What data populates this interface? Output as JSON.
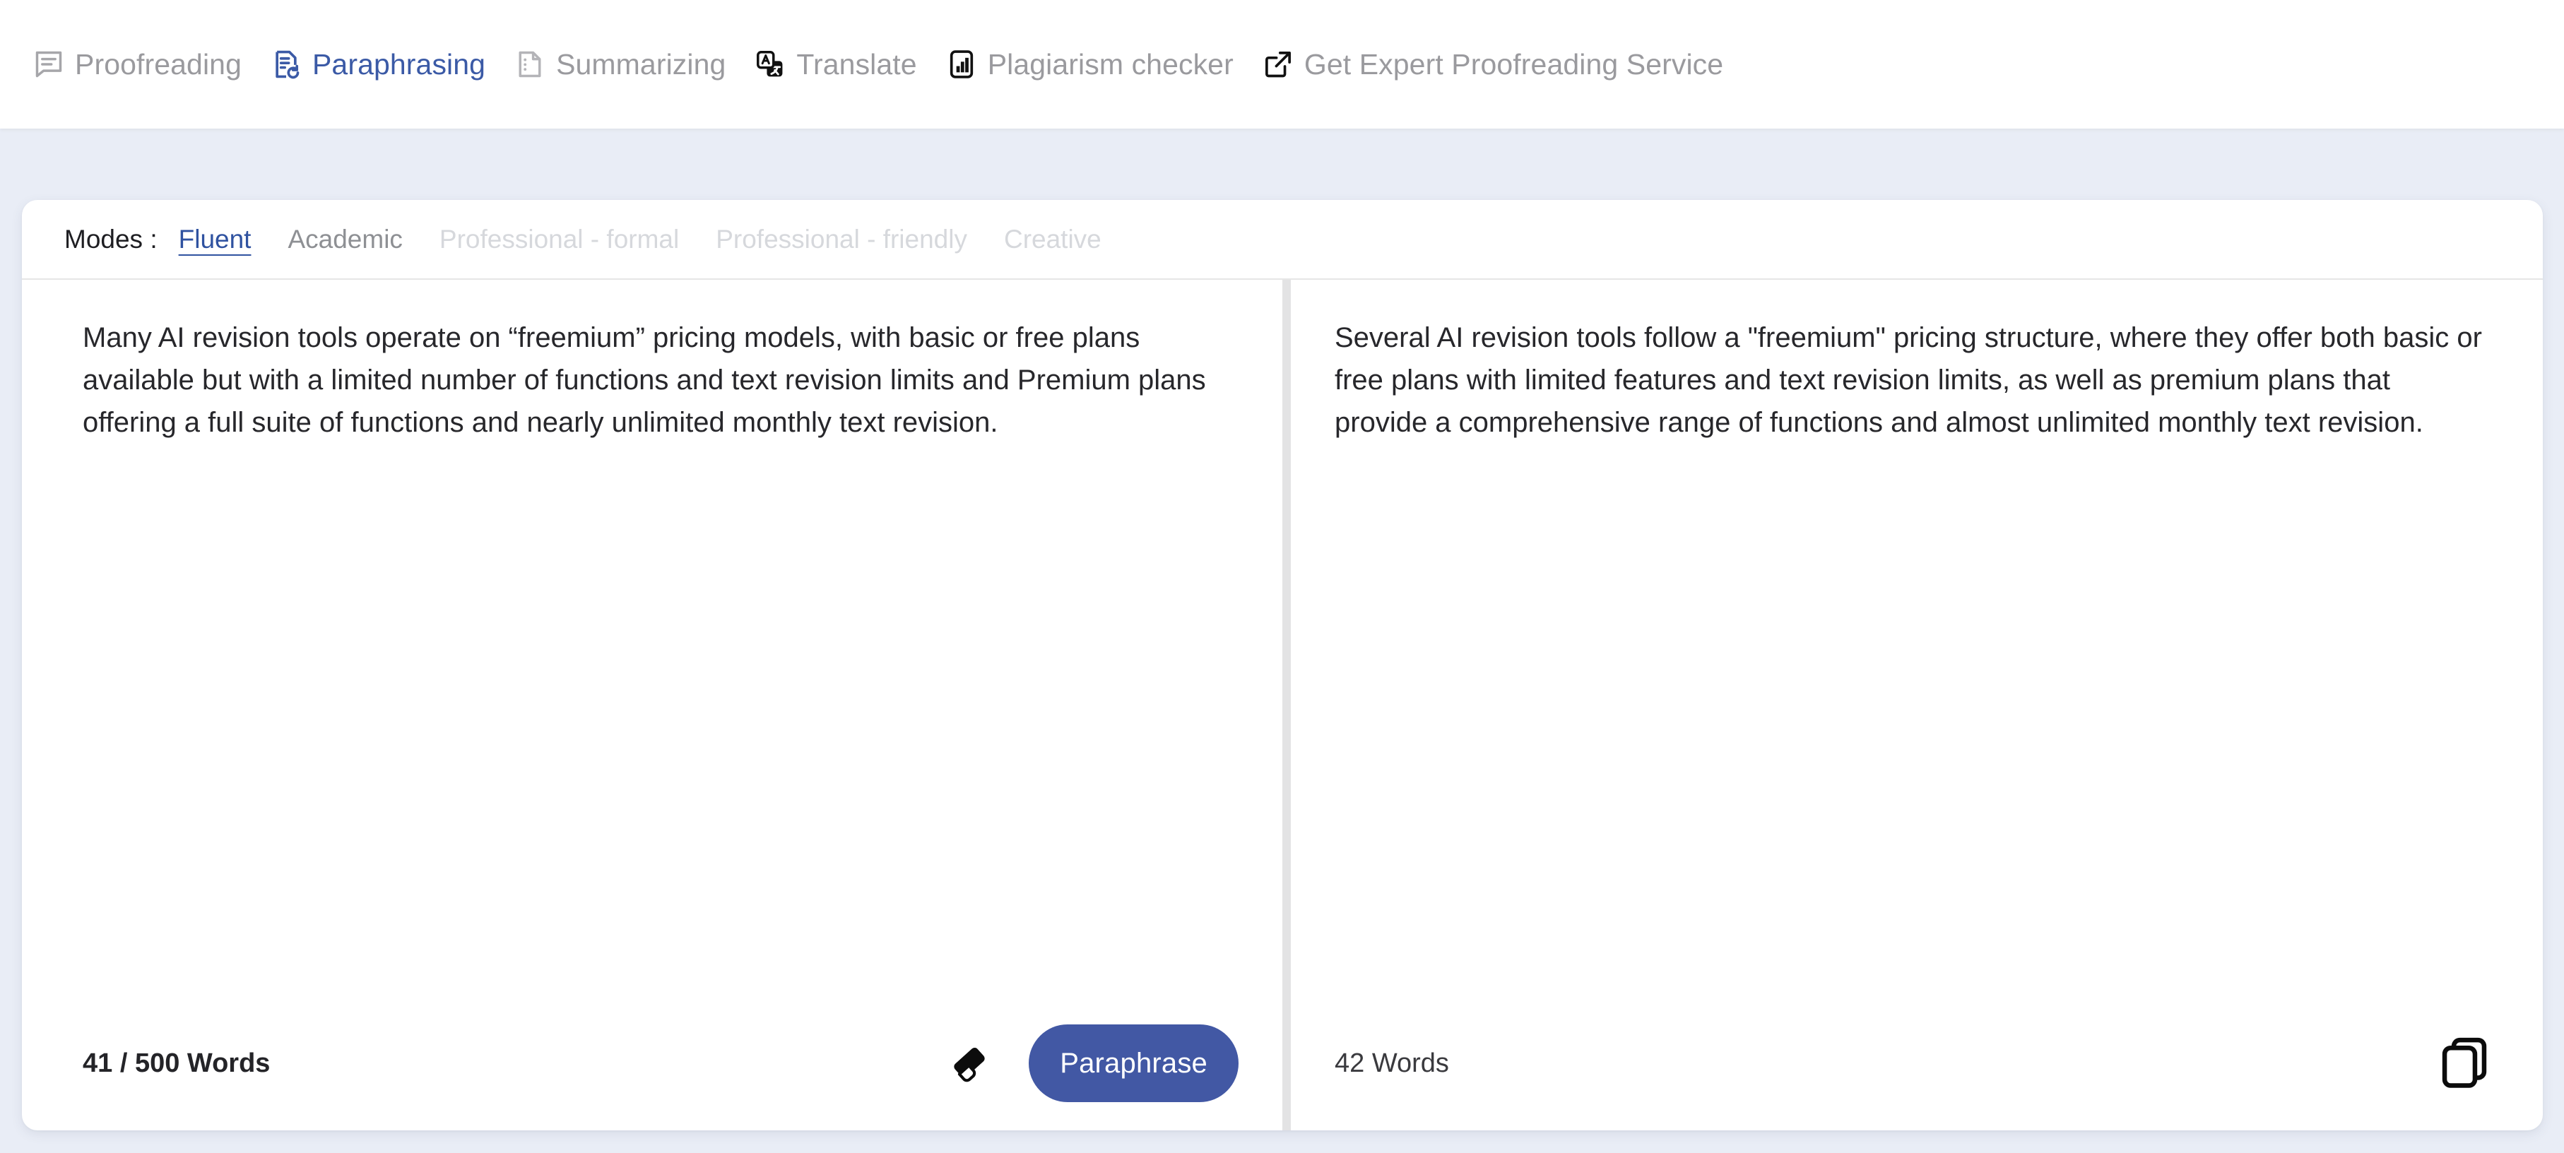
{
  "topnav": {
    "items": [
      {
        "id": "proofreading",
        "label": "Proofreading",
        "icon": "comment-lines-icon",
        "active": false
      },
      {
        "id": "paraphrasing",
        "label": "Paraphrasing",
        "icon": "document-revision-icon",
        "active": true
      },
      {
        "id": "summarizing",
        "label": "Summarizing",
        "icon": "document-summary-icon",
        "active": false
      },
      {
        "id": "translate",
        "label": "Translate",
        "icon": "translate-icon",
        "active": false
      },
      {
        "id": "plagiarism",
        "label": "Plagiarism checker",
        "icon": "bar-chart-icon",
        "active": false
      },
      {
        "id": "expert",
        "label": "Get Expert Proofreading Service",
        "icon": "external-link-icon",
        "active": false
      }
    ]
  },
  "modes": {
    "title": "Modes :",
    "items": [
      {
        "id": "fluent",
        "label": "Fluent",
        "state": "selected"
      },
      {
        "id": "academic",
        "label": "Academic",
        "state": "normal"
      },
      {
        "id": "professional-formal",
        "label": "Professional - formal",
        "state": "dim"
      },
      {
        "id": "professional-friendly",
        "label": "Professional - friendly",
        "state": "dim"
      },
      {
        "id": "creative",
        "label": "Creative",
        "state": "dim"
      }
    ]
  },
  "editor": {
    "input_text": "Many AI revision tools operate on “freemium” pricing models, with basic or free plans available but with a limited number of functions and text revision limits and Premium plans offering a full suite of functions and nearly unlimited monthly text revision.",
    "input_wordcount": "41 / 500 Words",
    "clear_icon": "eraser-icon",
    "paraphrase_label": "Paraphrase"
  },
  "output": {
    "output_text": "Several AI revision tools follow a \"freemium\" pricing structure, where they offer both basic or free plans with limited features and text revision limits, as well as premium plans that provide a comprehensive range of functions and almost unlimited monthly text revision.",
    "output_wordcount": "42 Words",
    "copy_icon": "copy-icon"
  },
  "colors": {
    "accent": "#4258a4",
    "active_nav": "#3b5aa6",
    "page_background": "#e9edf6",
    "card_background": "#ffffff",
    "muted_text": "#9a9a9e",
    "dim_text": "#d6d8dc"
  }
}
